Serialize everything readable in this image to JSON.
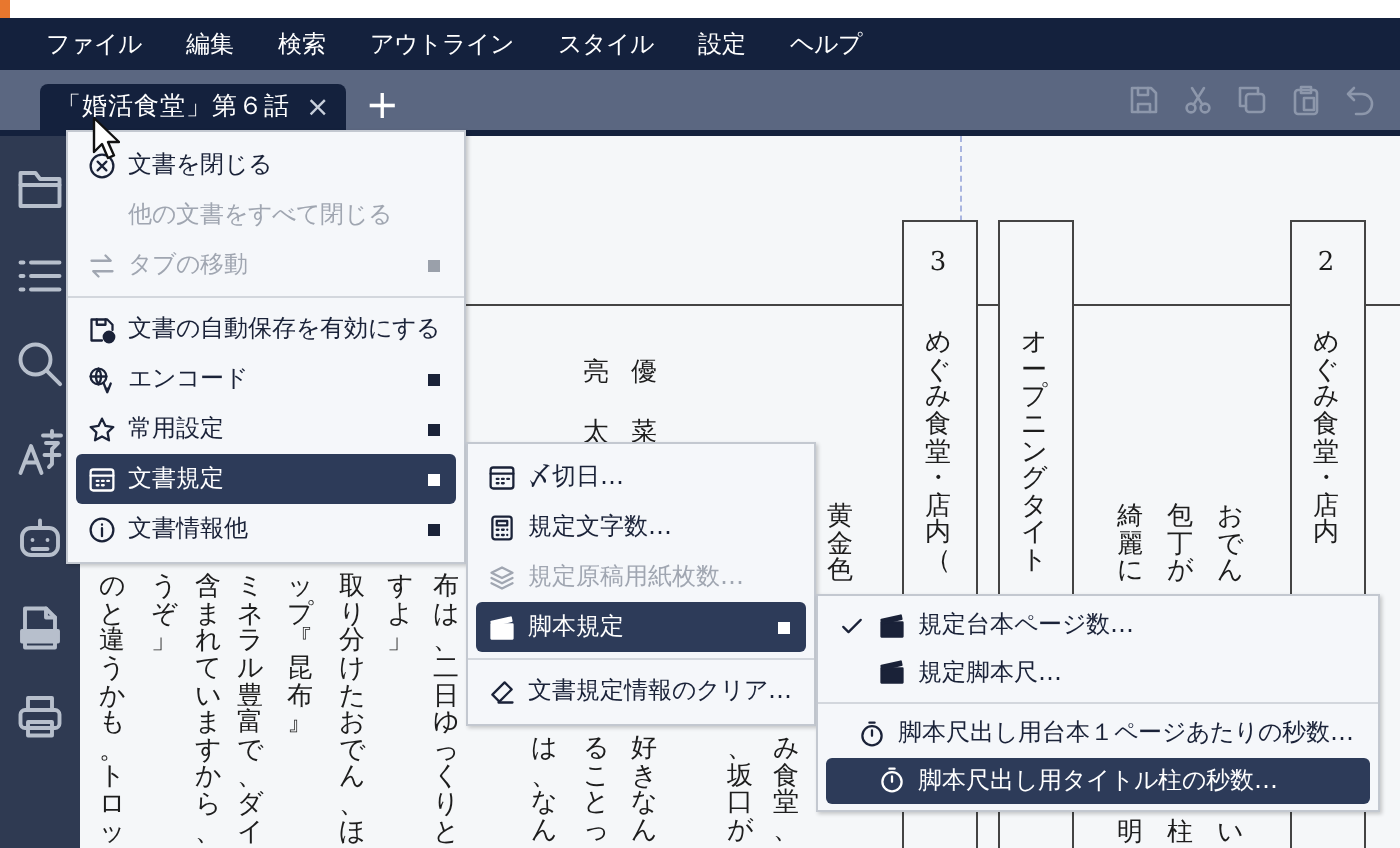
{
  "menu_bar": {
    "items": [
      "ファイル",
      "編集",
      "検索",
      "アウトライン",
      "スタイル",
      "設定",
      "ヘルプ"
    ]
  },
  "tabs": [
    {
      "label": "「婚活食堂」第６話",
      "close": "×",
      "selected": true
    }
  ],
  "new_tab": "+",
  "document": {
    "columns": [
      {
        "kind": "line",
        "text": "のと違うかも。トロッ"
      },
      {
        "kind": "line",
        "text": "うぞ」"
      },
      {
        "kind": "line",
        "text": "含まれていますから、"
      },
      {
        "kind": "line",
        "text": "ミネラル豊富で、ダイ"
      },
      {
        "kind": "line",
        "text": "ップ『昆布』"
      },
      {
        "kind": "line",
        "text": "取り分けたおでん、ほ"
      },
      {
        "kind": "line",
        "text": "すよ」"
      },
      {
        "kind": "line",
        "text": "布は、二日ゆっくりと"
      },
      {
        "kind": "line",
        "text": "は、なん"
      },
      {
        "kind": "name",
        "text": "亮太"
      },
      {
        "kind": "line",
        "text": "ることっ"
      },
      {
        "kind": "name",
        "text": "優菜"
      },
      {
        "kind": "line",
        "text": "好きなん"
      },
      {
        "kind": "line",
        "text": "、坂口が"
      },
      {
        "kind": "line",
        "text": "み食堂、"
      },
      {
        "kind": "line",
        "text": "黄金色"
      },
      {
        "kind": "heading",
        "text": "めぐみ食堂・店内（",
        "number": "3"
      },
      {
        "kind": "heading",
        "text": "オープニングタイト"
      },
      {
        "kind": "line",
        "text": "綺麗に"
      },
      {
        "kind": "line",
        "text": "明"
      },
      {
        "kind": "line",
        "text": "包丁が"
      },
      {
        "kind": "line",
        "text": "柱"
      },
      {
        "kind": "line",
        "text": "おでん"
      },
      {
        "kind": "line",
        "text": "い"
      },
      {
        "kind": "heading",
        "text": "めぐみ食堂・店内",
        "number": "2"
      }
    ]
  },
  "menus": [
    {
      "items": [
        {
          "kind": "item",
          "label": "文書を閉じる",
          "disabled": false,
          "submenu": false,
          "selected": false
        },
        {
          "kind": "item",
          "label": "他の文書をすべて閉じる",
          "disabled": true,
          "submenu": false,
          "selected": false
        },
        {
          "kind": "item",
          "label": "タブの移動",
          "disabled": true,
          "submenu": true,
          "selected": false
        },
        {
          "kind": "divider"
        },
        {
          "kind": "item",
          "label": "文書の自動保存を有効にする",
          "disabled": false,
          "submenu": false,
          "selected": false
        },
        {
          "kind": "item",
          "label": "エンコード",
          "disabled": false,
          "submenu": true,
          "selected": false
        },
        {
          "kind": "item",
          "label": "常用設定",
          "disabled": false,
          "submenu": true,
          "selected": false
        },
        {
          "kind": "item",
          "label": "文書規定",
          "disabled": false,
          "submenu": true,
          "selected": true
        },
        {
          "kind": "item",
          "label": "文書情報他",
          "disabled": false,
          "submenu": true,
          "selected": false
        }
      ]
    },
    {
      "items": [
        {
          "kind": "item",
          "label": "〆切日…",
          "disabled": false,
          "submenu": false,
          "selected": false
        },
        {
          "kind": "item",
          "label": "規定文字数…",
          "disabled": false,
          "submenu": false,
          "selected": false
        },
        {
          "kind": "item",
          "label": "規定原稿用紙枚数…",
          "disabled": true,
          "submenu": false,
          "selected": false
        },
        {
          "kind": "item",
          "label": "脚本規定",
          "disabled": false,
          "submenu": true,
          "selected": true
        },
        {
          "kind": "divider"
        },
        {
          "kind": "item",
          "label": "文書規定情報のクリア…",
          "disabled": false,
          "submenu": false,
          "selected": false
        }
      ]
    },
    {
      "items": [
        {
          "kind": "item",
          "label": "規定台本ページ数…",
          "disabled": false,
          "submenu": false,
          "selected": false,
          "checked": true
        },
        {
          "kind": "item",
          "label": "規定脚本尺…",
          "disabled": false,
          "submenu": false,
          "selected": false,
          "checked": false
        },
        {
          "kind": "divider"
        },
        {
          "kind": "item",
          "label": "脚本尺出し用台本１ページあたりの秒数…",
          "disabled": false,
          "submenu": false,
          "selected": false,
          "checked": false
        },
        {
          "kind": "item",
          "label": "脚本尺出し用タイトル柱の秒数…",
          "disabled": false,
          "submenu": false,
          "selected": true,
          "checked": false
        }
      ]
    }
  ]
}
